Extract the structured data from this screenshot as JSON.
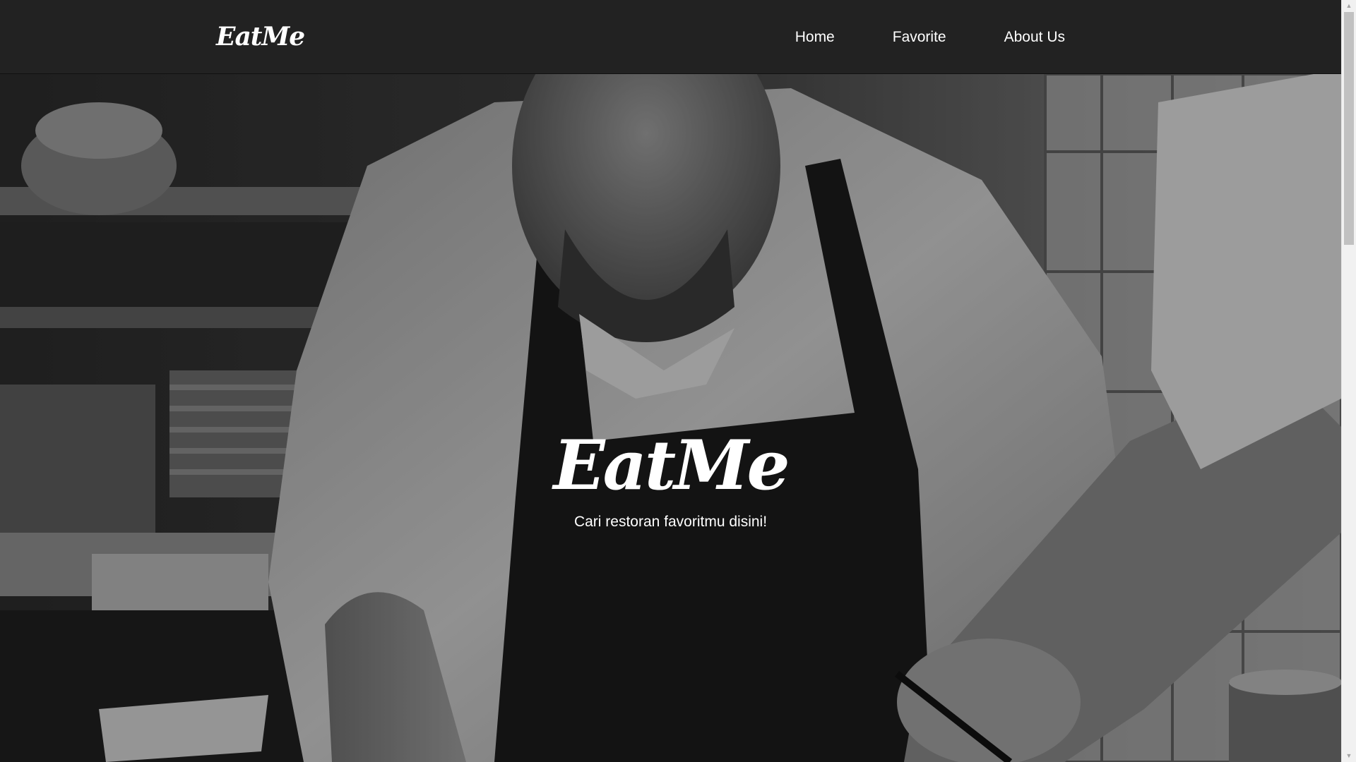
{
  "header": {
    "brand": "EatMe",
    "nav": [
      {
        "label": "Home"
      },
      {
        "label": "Favorite"
      },
      {
        "label": "About Us"
      }
    ]
  },
  "hero": {
    "title": "EatMe",
    "tagline": "Cari restoran favoritmu disini!",
    "image": "grayscale-chef-in-kitchen"
  },
  "colors": {
    "header_bg": "#222222",
    "text": "#ffffff",
    "scrollbar_track": "#f1f1f1",
    "scrollbar_thumb": "#c1c1c1"
  },
  "icons": {
    "scroll_up": "scroll-up-arrow-icon",
    "scroll_down": "scroll-down-arrow-icon"
  }
}
